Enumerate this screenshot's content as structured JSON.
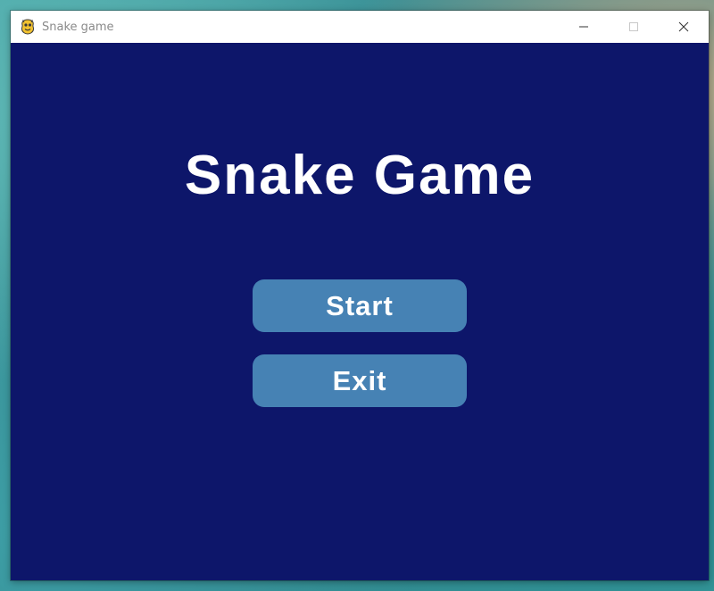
{
  "window": {
    "title": "Snake game",
    "icon": "pygame-snake-icon",
    "controls": [
      "minimize-icon",
      "maximize-icon",
      "close-icon"
    ]
  },
  "game": {
    "title": "Snake Game",
    "background_color": "#0d166a",
    "buttons": {
      "start_label": "Start",
      "exit_label": "Exit",
      "button_color": "#4682b4"
    }
  }
}
